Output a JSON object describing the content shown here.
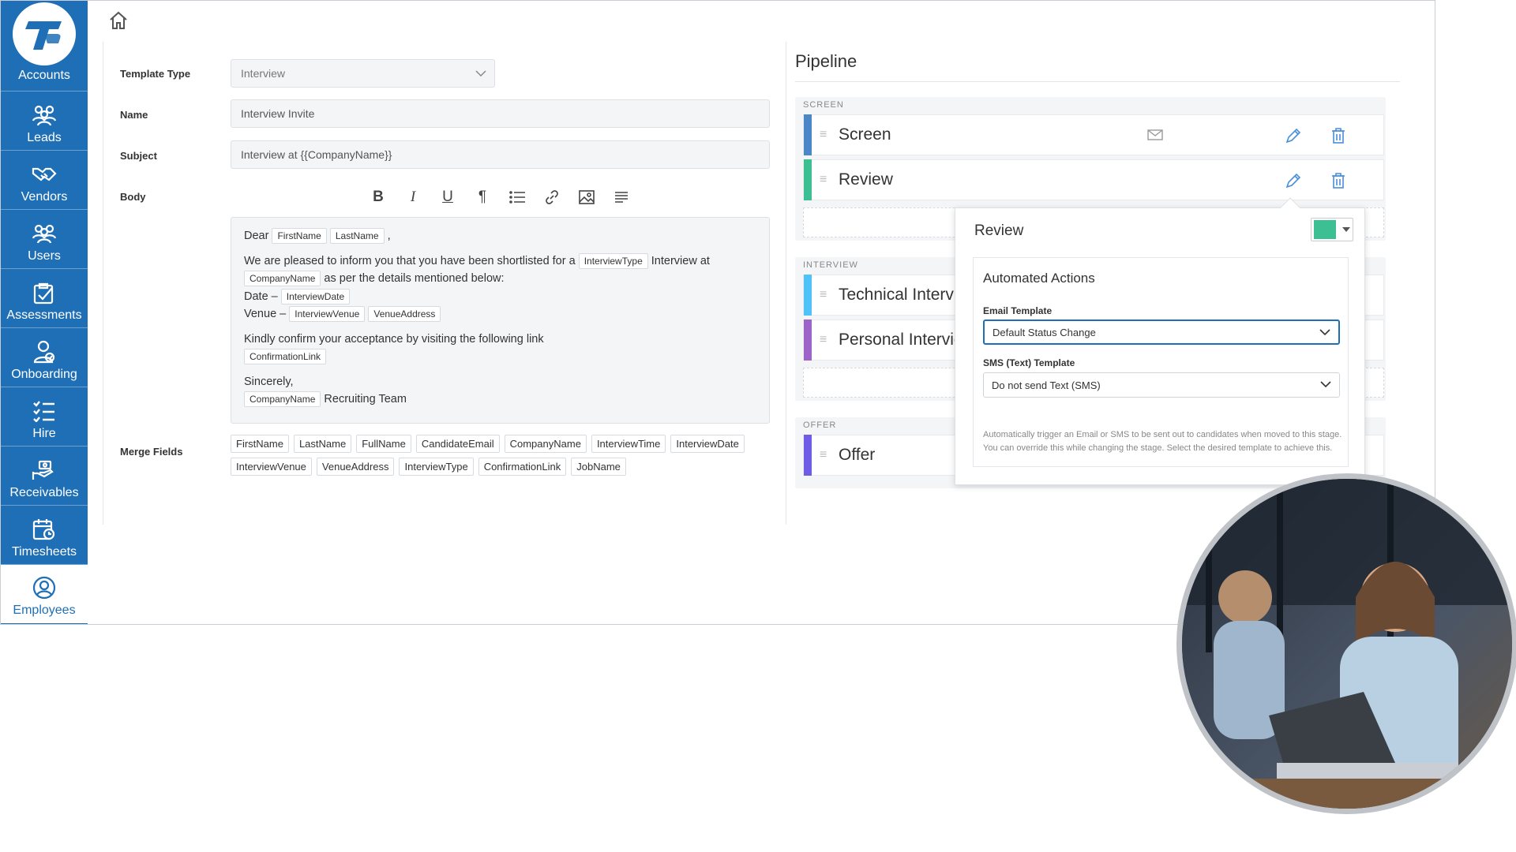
{
  "sidebar": {
    "items": [
      {
        "label": "Accounts",
        "icon": "tp-logo"
      },
      {
        "label": "Leads",
        "icon": "people-icon"
      },
      {
        "label": "Vendors",
        "icon": "handshake-icon"
      },
      {
        "label": "Users",
        "icon": "users-icon"
      },
      {
        "label": "Assessments",
        "icon": "clipboard-icon"
      },
      {
        "label": "Onboarding",
        "icon": "onboarding-icon"
      },
      {
        "label": "Hire",
        "icon": "checklist-icon"
      },
      {
        "label": "Receivables",
        "icon": "hand-money-icon"
      },
      {
        "label": "Timesheets",
        "icon": "calendar-clock-icon"
      },
      {
        "label": "Employees",
        "icon": "user-circle-icon"
      }
    ],
    "logo_text": "T"
  },
  "form": {
    "template_type_label": "Template Type",
    "template_type_value": "Interview",
    "name_label": "Name",
    "name_value": "Interview Invite",
    "subject_label": "Subject",
    "subject_value": "Interview at {{CompanyName}}",
    "body_label": "Body",
    "merge_label": "Merge Fields"
  },
  "editor": {
    "dear": "Dear",
    "comma": ",",
    "line1a": "We are pleased to inform you that you have been shortlisted for a",
    "line1b": "Interview at",
    "line2": "as per the details mentioned below:",
    "date_label": "Date –",
    "venue_label": "Venue –",
    "confirm": "Kindly confirm your acceptance by visiting the following link",
    "sincerely": "Sincerely,",
    "team": "Recruiting Team",
    "tags": {
      "first": "FirstName",
      "last": "LastName",
      "itype": "InterviewType",
      "company": "CompanyName",
      "idate": "InterviewDate",
      "ivenue": "InterviewVenue",
      "vaddr": "VenueAddress",
      "clink": "ConfirmationLink"
    }
  },
  "merge_fields": [
    "FirstName",
    "LastName",
    "FullName",
    "CandidateEmail",
    "CompanyName",
    "InterviewTime",
    "InterviewDate",
    "InterviewVenue",
    "VenueAddress",
    "InterviewType",
    "ConfirmationLink",
    "JobName"
  ],
  "pipeline": {
    "title": "Pipeline",
    "sections": {
      "screen": "SCREEN",
      "interview": "INTERVIEW",
      "offer": "OFFER"
    },
    "stages": {
      "screen": {
        "name": "Screen",
        "color": "#4a86c8"
      },
      "review": {
        "name": "Review",
        "color": "#3dbf94"
      },
      "technical": {
        "name": "Technical Interview",
        "color": "#4fc3f7"
      },
      "personal": {
        "name": "Personal Interview",
        "color": "#9c64c8"
      },
      "offer": {
        "name": "Offer",
        "color": "#6e5ce6"
      }
    }
  },
  "popover": {
    "title": "Review",
    "color": "#3dbf94",
    "section_title": "Automated Actions",
    "email_label": "Email Template",
    "email_value": "Default Status Change",
    "sms_label": "SMS (Text) Template",
    "sms_value": "Do not send Text (SMS)",
    "help": "Automatically trigger an Email or SMS to be sent out to candidates when moved to this stage. You can override this while changing the stage. Select the desired template to achieve this."
  }
}
